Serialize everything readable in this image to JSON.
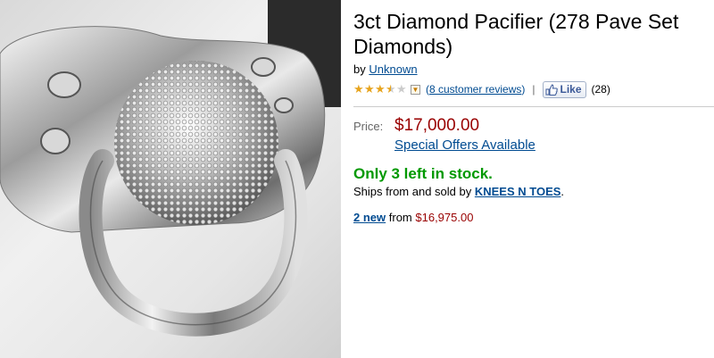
{
  "product": {
    "title": "3ct Diamond Pacifier (278 Pave Set Diamonds)",
    "by_label": "by",
    "brand": "Unknown",
    "image_alt": "diamond pacifier photo"
  },
  "rating": {
    "stars": 3.5,
    "reviews_link": "8 customer reviews",
    "open_paren": "(",
    "close_paren": ")",
    "separator": "|",
    "like_label": "Like",
    "like_count": "(28)"
  },
  "pricing": {
    "price_label": "Price:",
    "price": "$17,000.00",
    "special_offers": "Special Offers Available"
  },
  "availability": {
    "stock": "Only 3 left in stock.",
    "ships_prefix": "Ships from and sold by",
    "seller": "KNEES N TOES",
    "ships_suffix": "."
  },
  "new_offers": {
    "count_link": "2 new",
    "from_label": "from",
    "from_price": "$16,975.00"
  },
  "colors": {
    "link": "#004b91",
    "price": "#990000",
    "stock": "#009900",
    "star": "#e7a41e"
  },
  "icons": [
    "star-icon",
    "chevron-down-icon",
    "thumbs-up-icon"
  ]
}
